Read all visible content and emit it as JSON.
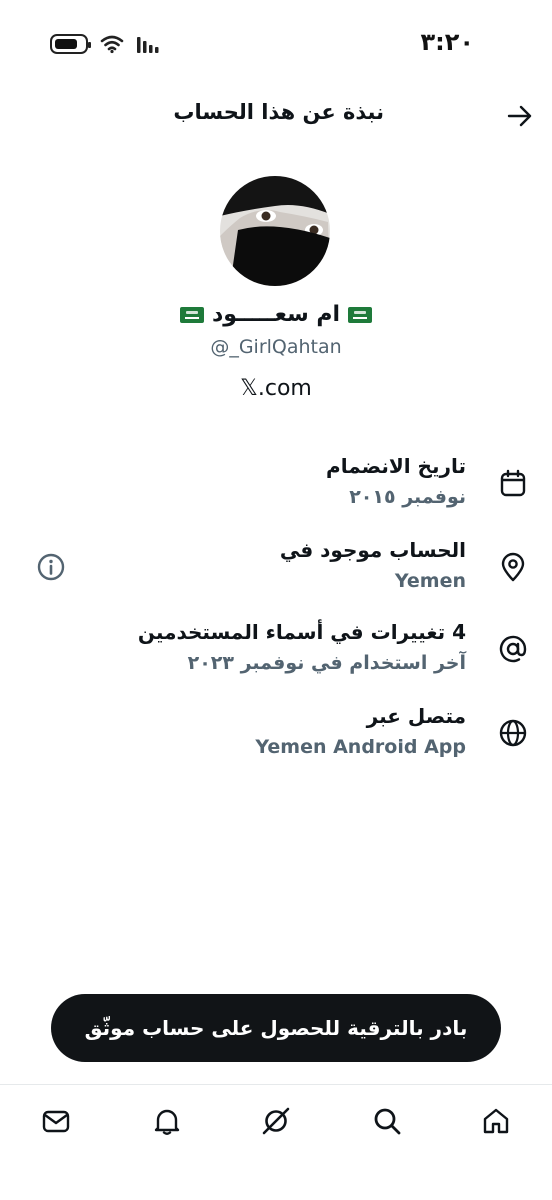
{
  "status_bar": {
    "time": "٣:٢٠"
  },
  "header": {
    "title": "نبذة عن هذا الحساب",
    "back_icon": "arrow-right-icon"
  },
  "profile": {
    "name": "ام سعـــــود",
    "handle": "@_GirlQahtan",
    "website": "𝕏.com",
    "flag_icon": "saudi-flag-icon"
  },
  "info": {
    "joined": {
      "label": "تاريخ الانضمام",
      "value": "نوفمبر ٢٠١٥",
      "icon": "calendar-icon"
    },
    "location": {
      "label": "الحساب موجود في",
      "value": "Yemen",
      "icon": "location-pin-icon"
    },
    "username_changes": {
      "label": "4 تغييرات في أسماء المستخدمين",
      "value": "آخر استخدام في نوفمبر ٢٠٢٣",
      "icon": "at-sign-icon"
    },
    "connected_via": {
      "label": "متصل عبر",
      "value": "Yemen Android App",
      "icon": "globe-icon"
    }
  },
  "upgrade": {
    "label": "بادر بالترقية للحصول على حساب موثّق"
  },
  "nav": [
    "mail-icon",
    "bell-icon",
    "grok-icon",
    "search-icon",
    "home-icon"
  ],
  "colors": {
    "primary_text": "#0f1419",
    "secondary_text": "#536471",
    "pill_background": "#111417",
    "flag_green": "#1e7a3a"
  }
}
